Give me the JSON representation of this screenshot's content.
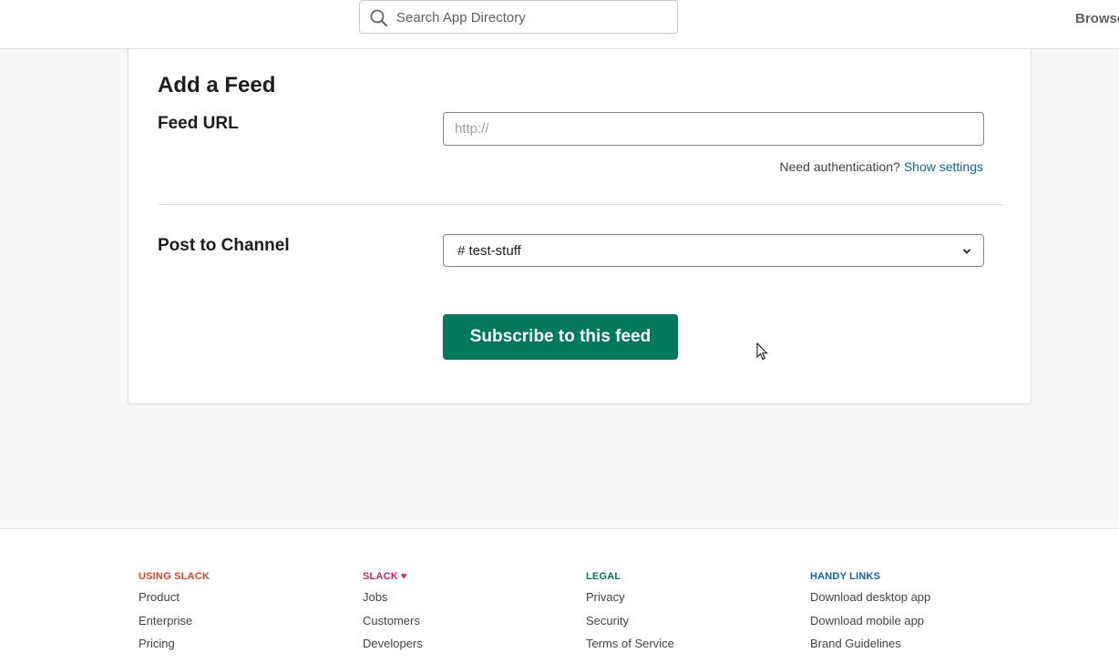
{
  "header": {
    "search_placeholder": "Search App Directory",
    "browse_label": "Browse"
  },
  "form": {
    "title": "Add a Feed",
    "feed_url_label": "Feed URL",
    "feed_url_placeholder": "http://",
    "feed_url_value": "",
    "auth_prompt": "Need authentication?",
    "auth_link": "Show settings",
    "post_channel_label": "Post to Channel",
    "channel_selected": "# test-stuff",
    "submit_label": "Subscribe to this feed"
  },
  "colors": {
    "primary_button": "#007a5a",
    "link": "#1264a3",
    "using_slack": "#e01e5a",
    "slack": "#e01e5a",
    "legal": "#007a5a",
    "handy_links": "#1264a3"
  },
  "footer": {
    "columns": [
      {
        "heading": "USING SLACK",
        "color": "#e0402a",
        "links": [
          "Product",
          "Enterprise",
          "Pricing"
        ]
      },
      {
        "heading": "SLACK",
        "heart": "♥",
        "color": "#e01e5a",
        "links": [
          "Jobs",
          "Customers",
          "Developers"
        ]
      },
      {
        "heading": "LEGAL",
        "color": "#007a5a",
        "links": [
          "Privacy",
          "Security",
          "Terms of Service"
        ]
      },
      {
        "heading": "HANDY LINKS",
        "color": "#1264a3",
        "links": [
          "Download desktop app",
          "Download mobile app",
          "Brand Guidelines"
        ]
      }
    ]
  }
}
